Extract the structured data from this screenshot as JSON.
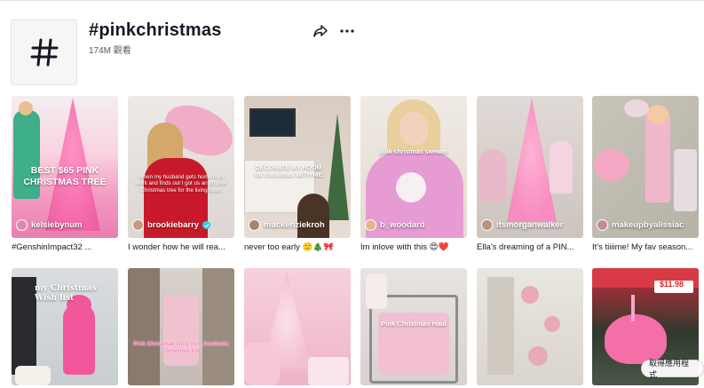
{
  "header": {
    "title": "#pinkchristmas",
    "views": "174M 觀看",
    "icons": {
      "hashtag": "hashtag-icon",
      "share": "share-icon",
      "more": "more-icon"
    }
  },
  "videos": [
    {
      "author": "kelsiebynum",
      "caption": "#GenshinImpact32 ...",
      "overlay": "BEST $65 PINK CHRISTMAS TREE",
      "verified": false
    },
    {
      "author": "brookiebarry",
      "caption": "I wonder how he will rea...",
      "overlay": "When my husband gets home from work and finds out I got us an 8ft pink Christmas tree for the living room",
      "verified": true
    },
    {
      "author": "mackenziekroh",
      "caption": "never too early 🙂🎄🎀",
      "overlay": "DECORATE MY ROOM for christmas WITH ME",
      "verified": false
    },
    {
      "author": "b_woodard",
      "caption": "Im inlove with this 😍❤️",
      "overlay": "pink christmas sweater",
      "verified": false
    },
    {
      "author": "itsmorganwalker",
      "caption": "Ella's dreaming of a PIN...",
      "overlay": "",
      "verified": false
    },
    {
      "author": "makeupbyalissiac",
      "caption": "It's tiiiime! My fav season...",
      "overlay": "",
      "verified": false
    },
    {
      "author": "",
      "caption": "",
      "overlay": "my Christmas Wish list",
      "verified": false
    },
    {
      "author": "",
      "caption": "",
      "overlay": "Pink Christmas Girly Non Aesthetic Christmas Kid",
      "verified": false
    },
    {
      "author": "",
      "caption": "",
      "overlay": "",
      "verified": false
    },
    {
      "author": "",
      "caption": "",
      "overlay": "Pink Christmas Haul",
      "verified": false
    },
    {
      "author": "",
      "caption": "",
      "overlay": "",
      "verified": false
    },
    {
      "author": "",
      "caption": "",
      "overlay": "$11.98",
      "verified": false
    }
  ],
  "app_button": "取得應用程式",
  "colors": {
    "pink": "#f5a9c8",
    "hot_pink": "#f06aa8",
    "verified": "#20d5ec"
  }
}
